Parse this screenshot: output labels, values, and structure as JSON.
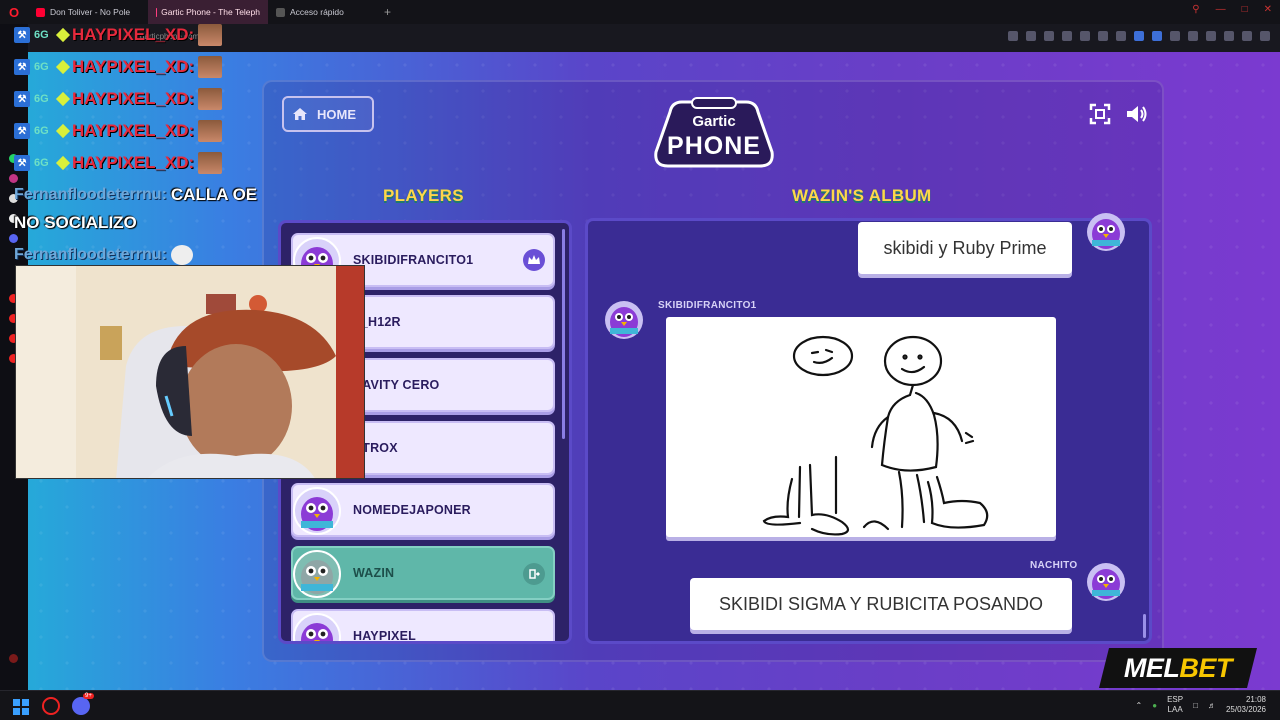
{
  "browser": {
    "tabs": [
      {
        "label": "Don Toliver - No Pole",
        "active": false,
        "icon_color": "#ff0033"
      },
      {
        "label": "Gartic Phone - The Teleph",
        "active": true,
        "icon_color": "#ff3d7f"
      },
      {
        "label": "Acceso rápido",
        "active": false,
        "icon_color": "#888888"
      }
    ],
    "address": "garticphone.com"
  },
  "game": {
    "home_label": "HOME",
    "logo_line1": "Gartic",
    "logo_line2": "PHONE",
    "players_title": "PLAYERS",
    "album_title": "WAZIN'S ALBUM",
    "players": [
      {
        "name": "SKIBIDIFRANCITO1",
        "host": true,
        "current": false
      },
      {
        "name": "Z_H12R",
        "host": false,
        "current": false
      },
      {
        "name": "RAVITY CERO",
        "host": false,
        "current": false
      },
      {
        "name": "NTROX",
        "host": false,
        "current": false
      },
      {
        "name": "NOMEDEJAPONER",
        "host": false,
        "current": false
      },
      {
        "name": "WAZIN",
        "host": false,
        "current": true
      },
      {
        "name": "HAYPIXEL",
        "host": false,
        "current": false
      }
    ],
    "album": {
      "first_message": "skibidi y Ruby Prime",
      "drawing_author": "SKIBIDIFRANCITO1",
      "last_author": "NACHITO",
      "last_message": "SKIBIDI SIGMA Y RUBICITA POSANDO"
    }
  },
  "chat": {
    "lines": [
      {
        "badge": "6G",
        "user": "HAYPIXEL_XD:"
      },
      {
        "badge": "6G",
        "user": "HAYPIXEL_XD:"
      },
      {
        "badge": "6G",
        "user": "HAYPIXEL_XD:"
      },
      {
        "badge": "6G",
        "user": "HAYPIXEL_XD:"
      },
      {
        "badge": "6G",
        "user": "HAYPIXEL_XD:"
      }
    ],
    "msg1_user": "Fernanfloodeterrnu:",
    "msg1_text": "CALLA OE",
    "msg2_text": "NO SOCIALIZO",
    "msg3_user": "Fernanfloodeterrnu:"
  },
  "sponsor": {
    "brand_white": "MEL",
    "brand_yellow": "BET"
  },
  "taskbar": {
    "lang_top": "ESP",
    "lang_bottom": "LAA",
    "time": "21:08",
    "date": "25/03/2026",
    "discord_badge": "9+"
  }
}
